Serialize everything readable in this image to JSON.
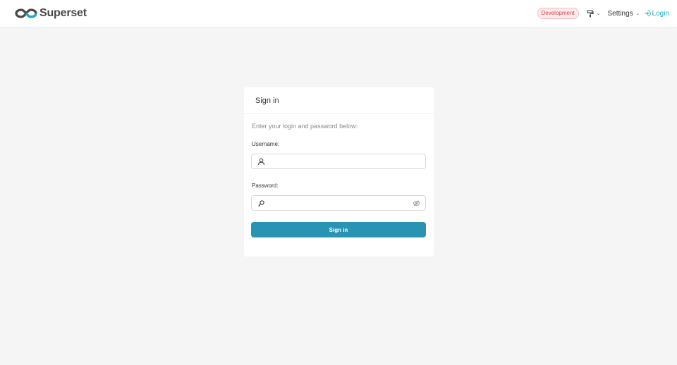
{
  "navbar": {
    "brand": {
      "name": "Superset",
      "icon": "superset-logo"
    },
    "environment_badge": "Development",
    "theme_menu": {
      "icon": "paint-roller-icon"
    },
    "settings_label": "Settings",
    "login": {
      "label": "Login",
      "icon": "login-icon"
    }
  },
  "login_card": {
    "title": "Sign in",
    "hint": "Enter your login and password below:",
    "username": {
      "label": "Username:",
      "value": "",
      "placeholder": "",
      "icon": "user-icon"
    },
    "password": {
      "label": "Password:",
      "value": "",
      "placeholder": "",
      "icon": "key-icon",
      "toggle_icon": "eye-invisible-icon"
    },
    "submit_label": "Sign in"
  },
  "colors": {
    "accent": "#20a7c9",
    "button": "#2893b3",
    "badge_text": "#d9434f",
    "background": "#f5f5f5"
  }
}
